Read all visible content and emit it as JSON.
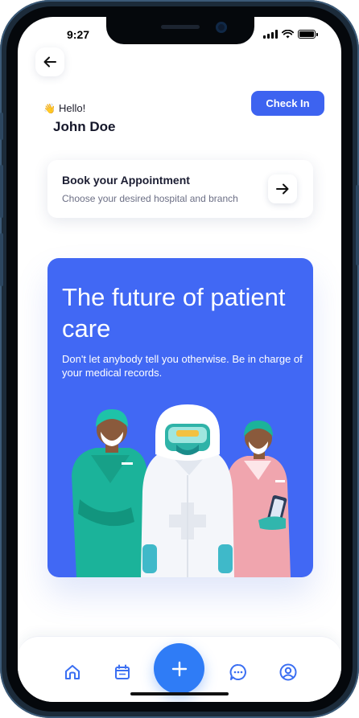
{
  "status_bar": {
    "time": "9:27"
  },
  "header": {
    "greeting": "Hello!",
    "wave_emoji": "👋",
    "user_name": "John Doe",
    "checkin_label": "Check In"
  },
  "appointment": {
    "title": "Book your Appointment",
    "subtitle": "Choose your desired hospital and branch"
  },
  "promo": {
    "title": "The future of patient care",
    "subtitle": "Don't let anybody tell you otherwise. Be in charge of your medical records."
  },
  "bottom_nav": {
    "items": [
      "home-icon",
      "calendar-icon",
      "add-icon",
      "chat-icon",
      "profile-icon"
    ]
  },
  "colors": {
    "accent": "#3d63f0",
    "promo_bg": "#4168f4",
    "fab": "#2f7cf6",
    "icon": "#3b6ff2"
  }
}
